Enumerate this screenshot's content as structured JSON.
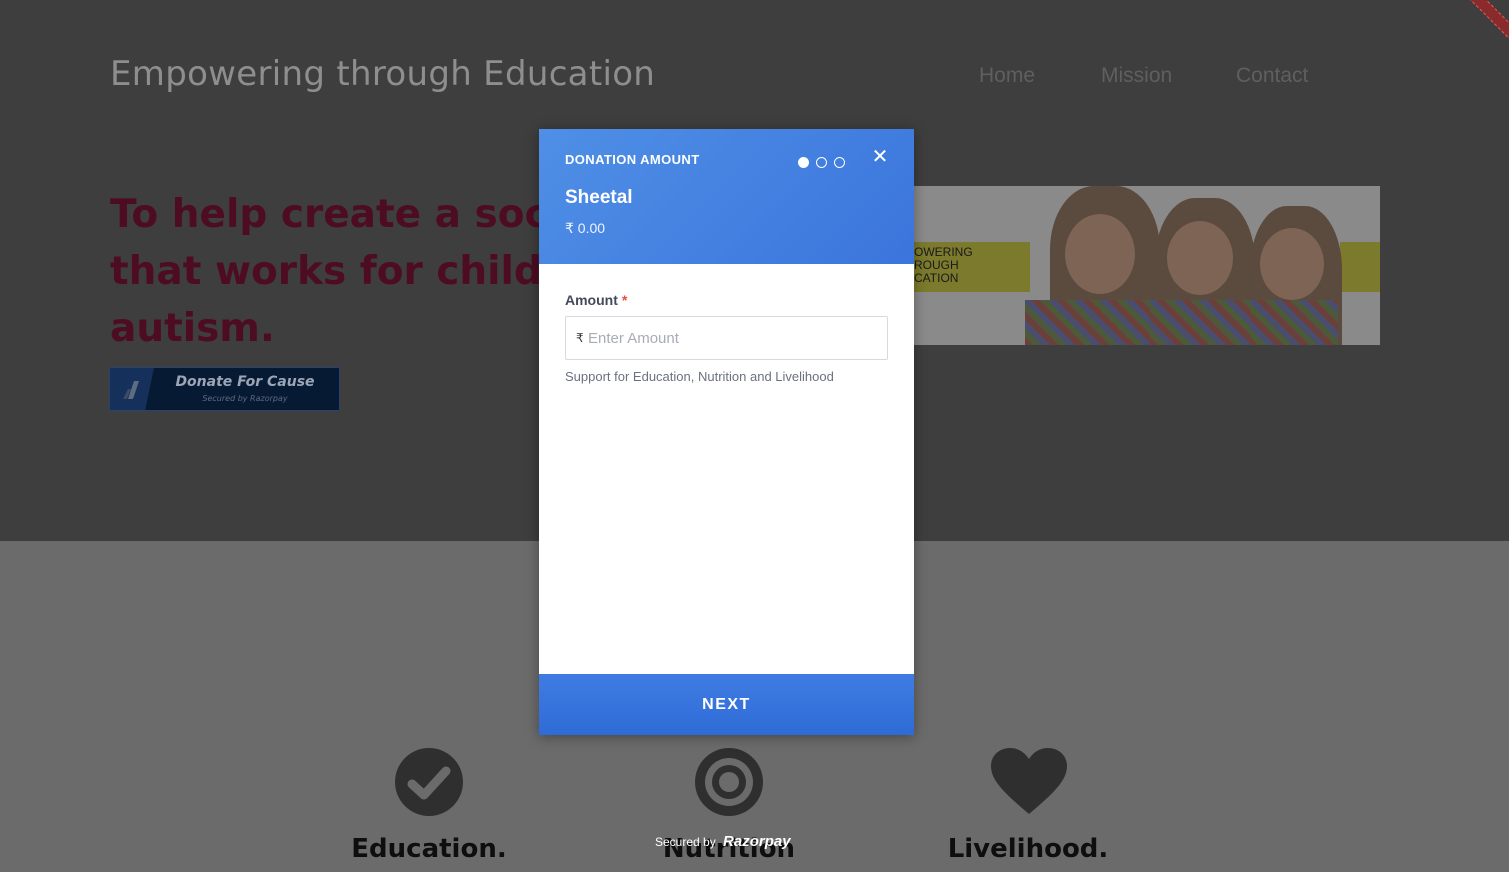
{
  "site": {
    "title": "Empowering through Education",
    "nav": [
      "Home",
      "Mission",
      "Contact"
    ],
    "headline_lines": "To help create a soc\nthat works for child\nautism.",
    "donate_button": {
      "label": "Donate For Cause",
      "sublabel": "Secured by Razorpay"
    },
    "banner_text": "OWERING\nROUGH\nCATION",
    "features": [
      {
        "label": "Education.",
        "icon": "check-circle-icon"
      },
      {
        "label": "Nutrition",
        "icon": "target-icon"
      },
      {
        "label": "Livelihood.",
        "icon": "heart-icon"
      }
    ]
  },
  "modal": {
    "title": "DONATION AMOUNT",
    "steps": {
      "total": 3,
      "current": 1
    },
    "close_icon": "close-icon",
    "merchant": "Sheetal",
    "total_display": "₹ 0.00",
    "amount_field": {
      "label": "Amount",
      "required_mark": "*",
      "currency_symbol": "₹",
      "placeholder": "Enter Amount",
      "value": ""
    },
    "help_text": "Support for Education, Nutrition and Livelihood",
    "next_label": "NEXT"
  },
  "footer": {
    "secured_by": "Secured by",
    "brand": "Razorpay"
  },
  "colors": {
    "modal_header": "#4a88e4",
    "next_button": "#3573db",
    "headline": "#4d0c22",
    "overlay_top": "#3e3e3e",
    "overlay_bottom": "#6b6b6b"
  }
}
